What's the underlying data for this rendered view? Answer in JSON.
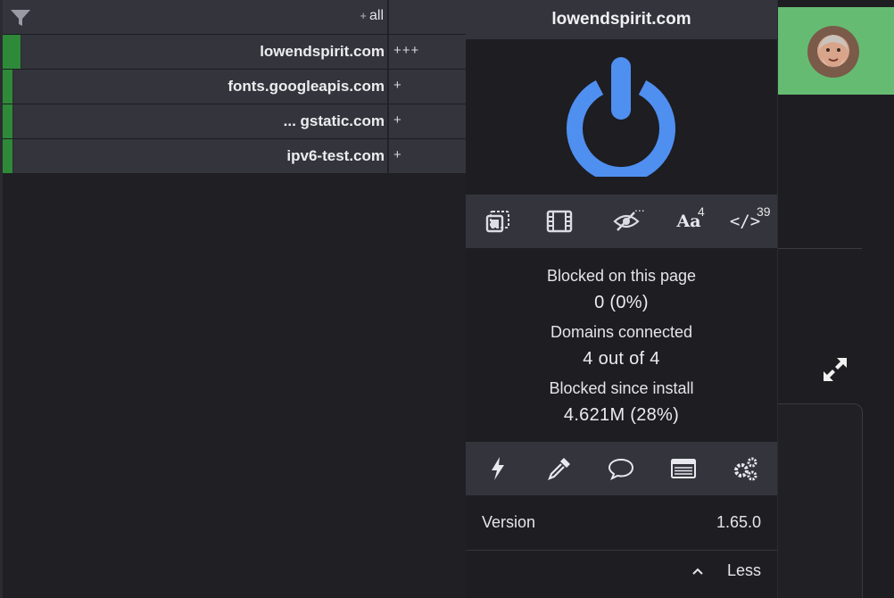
{
  "firewall": {
    "all_row": {
      "plus": "+",
      "label": "all"
    },
    "rows": [
      {
        "domain": "lowendspirit.com",
        "count": "+++"
      },
      {
        "domain": "fonts.googleapis.com",
        "count": "+"
      },
      {
        "domain": "... gstatic.com",
        "count": "+"
      },
      {
        "domain": "ipv6-test.com",
        "count": "+"
      }
    ]
  },
  "panel": {
    "hostname": "lowendspirit.com",
    "power_color": "#4f8ff0",
    "tools": [
      {
        "icon": "element-picker-icon"
      },
      {
        "icon": "media-film-icon"
      },
      {
        "icon": "cosmetic-filter-eye-icon",
        "badge": "..."
      },
      {
        "icon": "remote-fonts-icon",
        "label": "Aa",
        "badge": "4"
      },
      {
        "icon": "javascript-code-icon",
        "label": "</>",
        "badge": "39"
      }
    ],
    "stats": {
      "blocked_page_label": "Blocked on this page",
      "blocked_page_value": "0 (0%)",
      "domains_label": "Domains connected",
      "domains_value": "4 out of 4",
      "blocked_install_label": "Blocked since install",
      "blocked_install_value": "4.621M (28%)"
    },
    "actions": [
      {
        "icon": "lightning-icon"
      },
      {
        "icon": "eyedropper-icon"
      },
      {
        "icon": "speech-bubble-icon"
      },
      {
        "icon": "logger-list-icon"
      },
      {
        "icon": "settings-gears-icon"
      }
    ],
    "version_label": "Version",
    "version_value": "1.65.0",
    "less_label": "Less"
  },
  "colors": {
    "accent": "#4f8ff0",
    "allowed_green": "#2e8a38",
    "header_green": "#66bb72"
  }
}
